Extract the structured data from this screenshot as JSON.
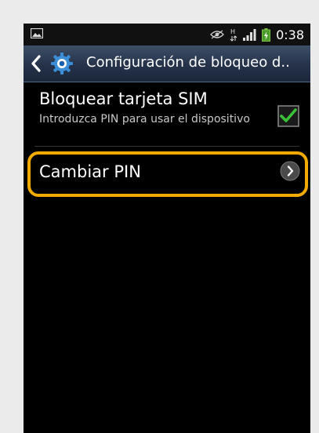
{
  "status_bar": {
    "time": "0:38",
    "icons": [
      "image-icon",
      "eye-icon",
      "hsdpa-icon",
      "signal-icon",
      "battery-charging-icon"
    ]
  },
  "action_bar": {
    "back_icon": "chevron-left-icon",
    "app_icon": "gear-icon",
    "title": "Configuración de bloqueo d.."
  },
  "settings": {
    "sim_lock": {
      "title": "Bloquear tarjeta SIM",
      "summary": "Introduzca PIN para usar el dispositivo",
      "checked": true
    },
    "change_pin": {
      "label": "Cambiar PIN",
      "icon": "chevron-right-icon"
    }
  },
  "colors": {
    "highlight": "#f2a900",
    "check": "#3ac13a",
    "action_bar": "#2a3850"
  }
}
